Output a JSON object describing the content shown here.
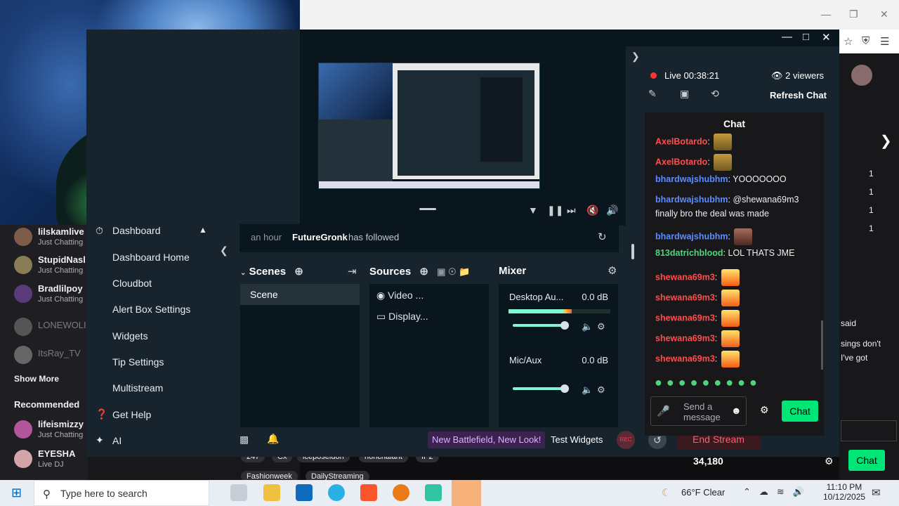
{
  "left_sidebar": {
    "channels": [
      {
        "name": "lilskamlive",
        "category": "Just Chatting",
        "color": "#7d5c4a",
        "offline": false
      },
      {
        "name": "StupidNasl",
        "category": "Just Chatting",
        "color": "#8a7d55",
        "offline": false
      },
      {
        "name": "Bradlilpoy",
        "category": "Just Chatting",
        "color": "#5a3b7a",
        "offline": false
      },
      {
        "name": "LONEWOLI",
        "category": "",
        "color": "#555555",
        "offline": true
      },
      {
        "name": "ItsRay_TV",
        "category": "",
        "color": "#666666",
        "offline": true
      }
    ],
    "show_more": "Show More",
    "recommended_label": "Recommended",
    "recommended": [
      {
        "name": "lifeismizzy",
        "category": "Just Chatting",
        "color": "#b2569b"
      },
      {
        "name": "EYESHA",
        "category": "Live DJ",
        "color": "#d3a4a8"
      }
    ]
  },
  "dashboard_menu": {
    "header": "Dashboard",
    "items": [
      "Dashboard Home",
      "Cloudbot",
      "Alert Box Settings",
      "Widgets",
      "Tip Settings",
      "Multistream"
    ],
    "get_help": "Get Help",
    "ai": "AI"
  },
  "activity": {
    "time": "an hour",
    "user": "FutureGronk",
    "action": "has followed"
  },
  "scenes": {
    "title": "Scenes",
    "items": [
      "Scene"
    ]
  },
  "sources": {
    "title": "Sources",
    "items": [
      "Video ...",
      "Display..."
    ]
  },
  "mixer": {
    "title": "Mixer",
    "channels": [
      {
        "name": "Desktop Au...",
        "db": "0.0 dB",
        "level": 0.62,
        "volume": 0.82
      },
      {
        "name": "Mic/Aux",
        "db": "0.0 dB",
        "level": 0,
        "volume": 0.82
      }
    ]
  },
  "bottom_bar": {
    "promo": "New Battlefield, New Look!",
    "test_widgets": "Test Widgets",
    "rec": "REC",
    "end_stream": "End Stream"
  },
  "chat_pane": {
    "live_label": "Live",
    "live_time": "00:38:21",
    "viewers": "2 viewers",
    "refresh": "Refresh Chat",
    "title": "Chat",
    "messages": [
      {
        "user": "AxelBotardo",
        "color": "#ff4d4d",
        "text": "",
        "emote": "heart"
      },
      {
        "user": "AxelBotardo",
        "color": "#ff4d4d",
        "text": "",
        "emote": "heart"
      },
      {
        "user": "bhardwajshubhm",
        "color": "#5b8cff",
        "text": "YOOOOOOO",
        "emote": ""
      },
      {
        "user": "bhardwajshubhm",
        "color": "#5b8cff",
        "text": "@shewana69m3",
        "emote": ""
      },
      {
        "user": "",
        "color": "#ffffff",
        "text": "finally bro the deal was made",
        "emote": ""
      },
      {
        "user": "bhardwajshubhm",
        "color": "#5b8cff",
        "text": "",
        "emote": "face"
      },
      {
        "user": "813datrichblood",
        "color": "#4ed47a",
        "text": "LOL THATS JME",
        "emote": ""
      },
      {
        "user": "shewana69m3",
        "color": "#ff4d4d",
        "text": "",
        "emote": "fire"
      },
      {
        "user": "shewana69m3",
        "color": "#ff4d4d",
        "text": "",
        "emote": "fire"
      },
      {
        "user": "shewana69m3",
        "color": "#ff4d4d",
        "text": "",
        "emote": "fire"
      },
      {
        "user": "shewana69m3",
        "color": "#ff4d4d",
        "text": "",
        "emote": "fire"
      },
      {
        "user": "shewana69m3",
        "color": "#ff4d4d",
        "text": "",
        "emote": "fire"
      }
    ],
    "input_placeholder": "Send a message",
    "chat_button": "Chat"
  },
  "twitch_right": {
    "counts": [
      "1",
      "1",
      "1",
      "1"
    ],
    "said": "said",
    "sings": "sings don't",
    "got": "I've got",
    "points": "34,180",
    "chat_button": "Chat"
  },
  "tags": [
    "247",
    "Cx",
    "iceposeidon",
    "nonchalant",
    "IP2",
    "Fashionweek",
    "DailyStreaming"
  ],
  "taskbar": {
    "search_placeholder": "Type here to search",
    "weather": "66°F  Clear",
    "time": "11:10 PM",
    "date": "10/12/2025"
  },
  "colors": {
    "accent_green": "#00e676",
    "streamlabs_bg": "#17242d",
    "end_stream": "#ff5e6b"
  }
}
